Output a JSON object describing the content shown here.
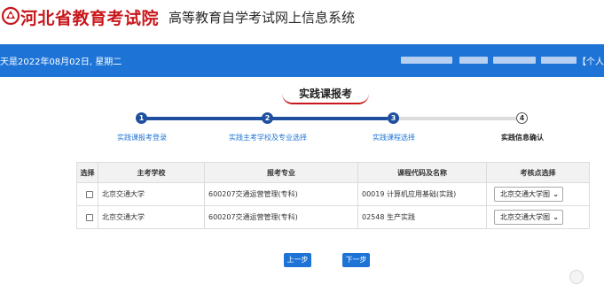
{
  "header": {
    "logo_icon": "exam-seal-icon",
    "org_name": "河北省教育考试院",
    "system_name": "高等教育自学考试网上信息系统"
  },
  "topbar": {
    "date_text": "天是2022年08月02日, 星期二",
    "user_link": "【个人",
    "background": "#1e74d6"
  },
  "page": {
    "title": "实践课报考"
  },
  "steps": [
    {
      "num": "1",
      "label": "实践课报考登录",
      "state": "done"
    },
    {
      "num": "2",
      "label": "实践主考学校及专业选择",
      "state": "done"
    },
    {
      "num": "3",
      "label": "实践课程选择",
      "state": "done"
    },
    {
      "num": "4",
      "label": "实践信息确认",
      "state": "todo"
    }
  ],
  "table": {
    "headers": [
      "选择",
      "主考学校",
      "报考专业",
      "课程代码及名称",
      "考核点选择"
    ],
    "rows": [
      {
        "school": "北京交通大学",
        "major": "600207交通运营管理(专科)",
        "course": "00019 计算机应用基础(实践)",
        "site": "北京交通大学图"
      },
      {
        "school": "北京交通大学",
        "major": "600207交通运营管理(专科)",
        "course": "02548 生产实践",
        "site": "北京交通大学图"
      }
    ]
  },
  "buttons": {
    "prev": "上一步",
    "next": "下一步"
  },
  "colors": {
    "brand_red": "#c8171c",
    "accent_blue": "#1e74d6",
    "step_blue": "#1f4f9e"
  }
}
